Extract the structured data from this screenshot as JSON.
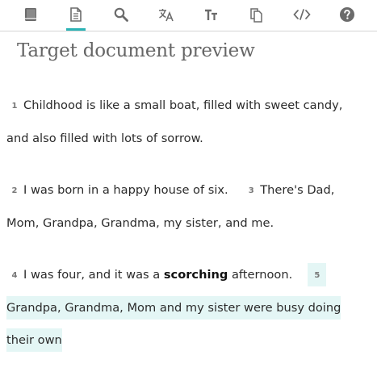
{
  "toolbar": {
    "tools": [
      {
        "icon": "book-icon",
        "label": "Source document",
        "active": false
      },
      {
        "icon": "document-icon",
        "label": "Target document preview",
        "active": true
      },
      {
        "icon": "search-icon",
        "label": "Search",
        "active": false
      },
      {
        "icon": "translate-icon",
        "label": "Translate",
        "active": false
      },
      {
        "icon": "text-size-icon",
        "label": "Text size",
        "active": false
      },
      {
        "icon": "copy-icon",
        "label": "Copy",
        "active": false
      },
      {
        "icon": "code-icon",
        "label": "Code",
        "active": false
      },
      {
        "icon": "help-icon",
        "label": "Help",
        "active": false
      }
    ],
    "accent": "#2bb3b5"
  },
  "title": "Target document preview",
  "paragraphs": [
    {
      "segments": [
        {
          "number": "1",
          "text": "Childhood is like a small boat, filled with sweet candy, and also filled with lots of sorrow.",
          "highlighted": false
        }
      ]
    },
    {
      "segments": [
        {
          "number": "2",
          "text": "I was born in a happy house of six.",
          "highlighted": false
        },
        {
          "number": "3",
          "text": "There's Dad, Mom, Grandpa, Grandma, my sister, and me.",
          "highlighted": false
        }
      ]
    },
    {
      "segments": [
        {
          "number": "4",
          "text_before": "I was four, and it was a",
          "bold": "scorching",
          "text_after": "afternoon.",
          "highlighted": false
        },
        {
          "number": "5",
          "text": "Grandpa, Grandma, Mom and my sister were busy doing their own",
          "highlighted": true
        }
      ]
    }
  ],
  "colors": {
    "highlight": "#e4f6f5",
    "title": "#666666",
    "text": "#2b2b2b"
  }
}
